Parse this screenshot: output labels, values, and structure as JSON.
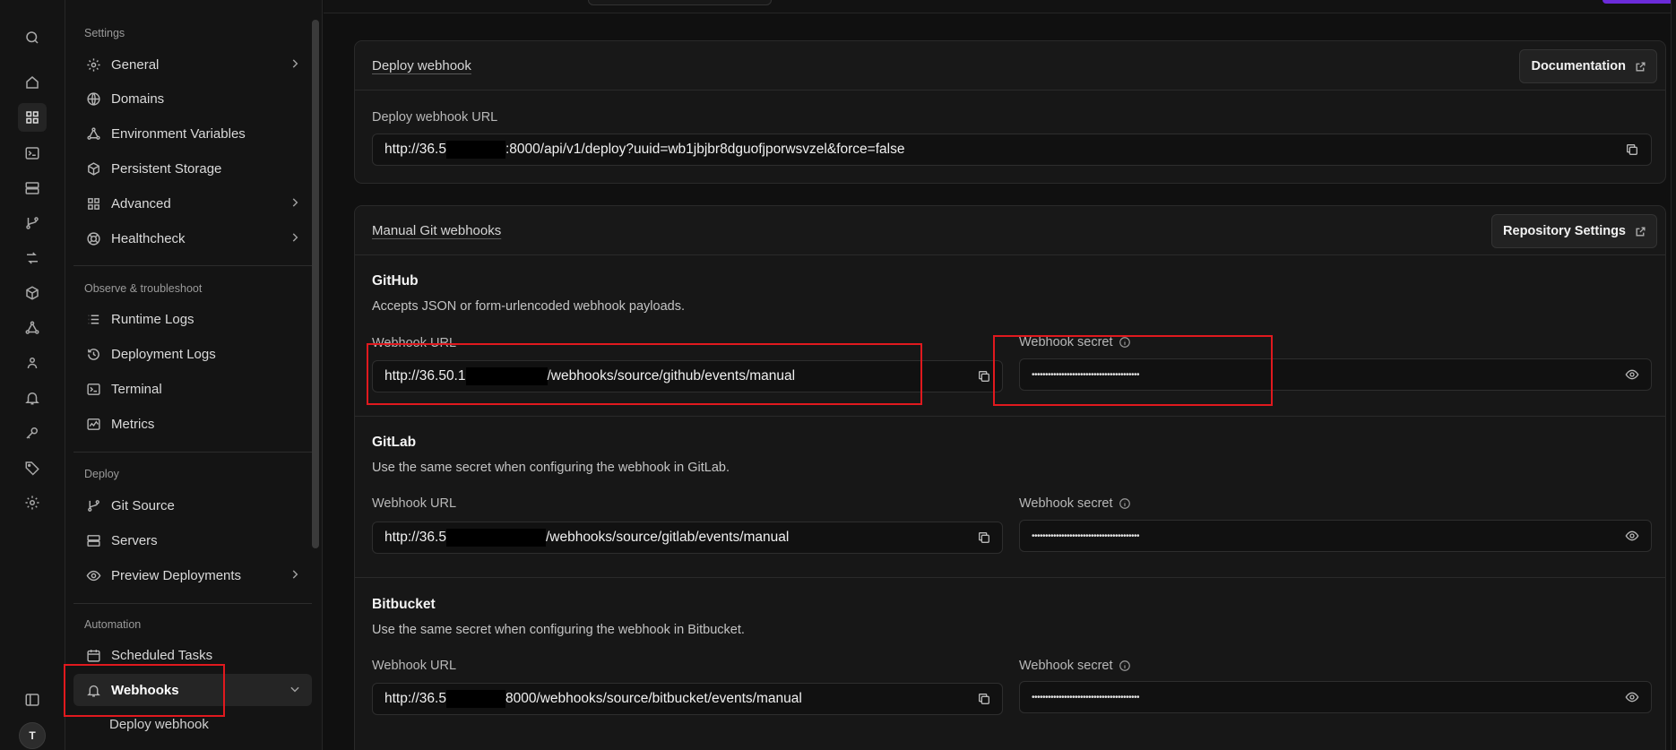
{
  "rail": {
    "icons": [
      "search-icon",
      "home-icon",
      "grid-icon",
      "terminal-icon",
      "servers-icon",
      "git-branch-icon",
      "routes-icon",
      "box-icon",
      "triangle-icon",
      "team-icon",
      "bell-icon",
      "key-icon",
      "tag-icon",
      "gear-icon",
      "sidebar-toggle-icon"
    ],
    "avatar_initial": "T"
  },
  "sidebar": {
    "sections": {
      "settings": "Settings",
      "observe": "Observe & troubleshoot",
      "deploy": "Deploy",
      "automation": "Automation"
    },
    "items": {
      "general": "General",
      "domains": "Domains",
      "env": "Environment Variables",
      "storage": "Persistent Storage",
      "advanced": "Advanced",
      "healthcheck": "Healthcheck",
      "runtime_logs": "Runtime Logs",
      "deployment_logs": "Deployment Logs",
      "terminal": "Terminal",
      "metrics": "Metrics",
      "git_source": "Git Source",
      "servers": "Servers",
      "preview": "Preview Deployments",
      "scheduled": "Scheduled Tasks",
      "webhooks": "Webhooks",
      "deploy_webhook": "Deploy webhook"
    }
  },
  "deploy_webhook": {
    "title": "Deploy webhook",
    "doc_button": "Documentation",
    "url_label": "Deploy webhook URL",
    "url_prefix": "http://36.5",
    "url_suffix": ":8000/api/v1/deploy?uuid=wb1jbjbr8dguofjporwsvzel&force=false"
  },
  "manual": {
    "title": "Manual Git webhooks",
    "repo_button": "Repository Settings",
    "url_label": "Webhook URL",
    "secret_label": "Webhook secret",
    "secret_mask": "••••••••••••••••••••••••••••••••••••••••",
    "github": {
      "name": "GitHub",
      "desc": "Accepts JSON or form-urlencoded webhook payloads.",
      "url_prefix": "http://36.50.1",
      "url_suffix": "/webhooks/source/github/events/manual"
    },
    "gitlab": {
      "name": "GitLab",
      "desc": "Use the same secret when configuring the webhook in GitLab.",
      "url_prefix": "http://36.5",
      "url_suffix": "/webhooks/source/gitlab/events/manual"
    },
    "bitbucket": {
      "name": "Bitbucket",
      "desc": "Use the same secret when configuring the webhook in Bitbucket.",
      "url_prefix": "http://36.5",
      "url_suffix": "8000/webhooks/source/bitbucket/events/manual"
    }
  },
  "colors": {
    "highlight": "#e0191e",
    "accent": "#6b2bd9",
    "background": "#101010"
  }
}
